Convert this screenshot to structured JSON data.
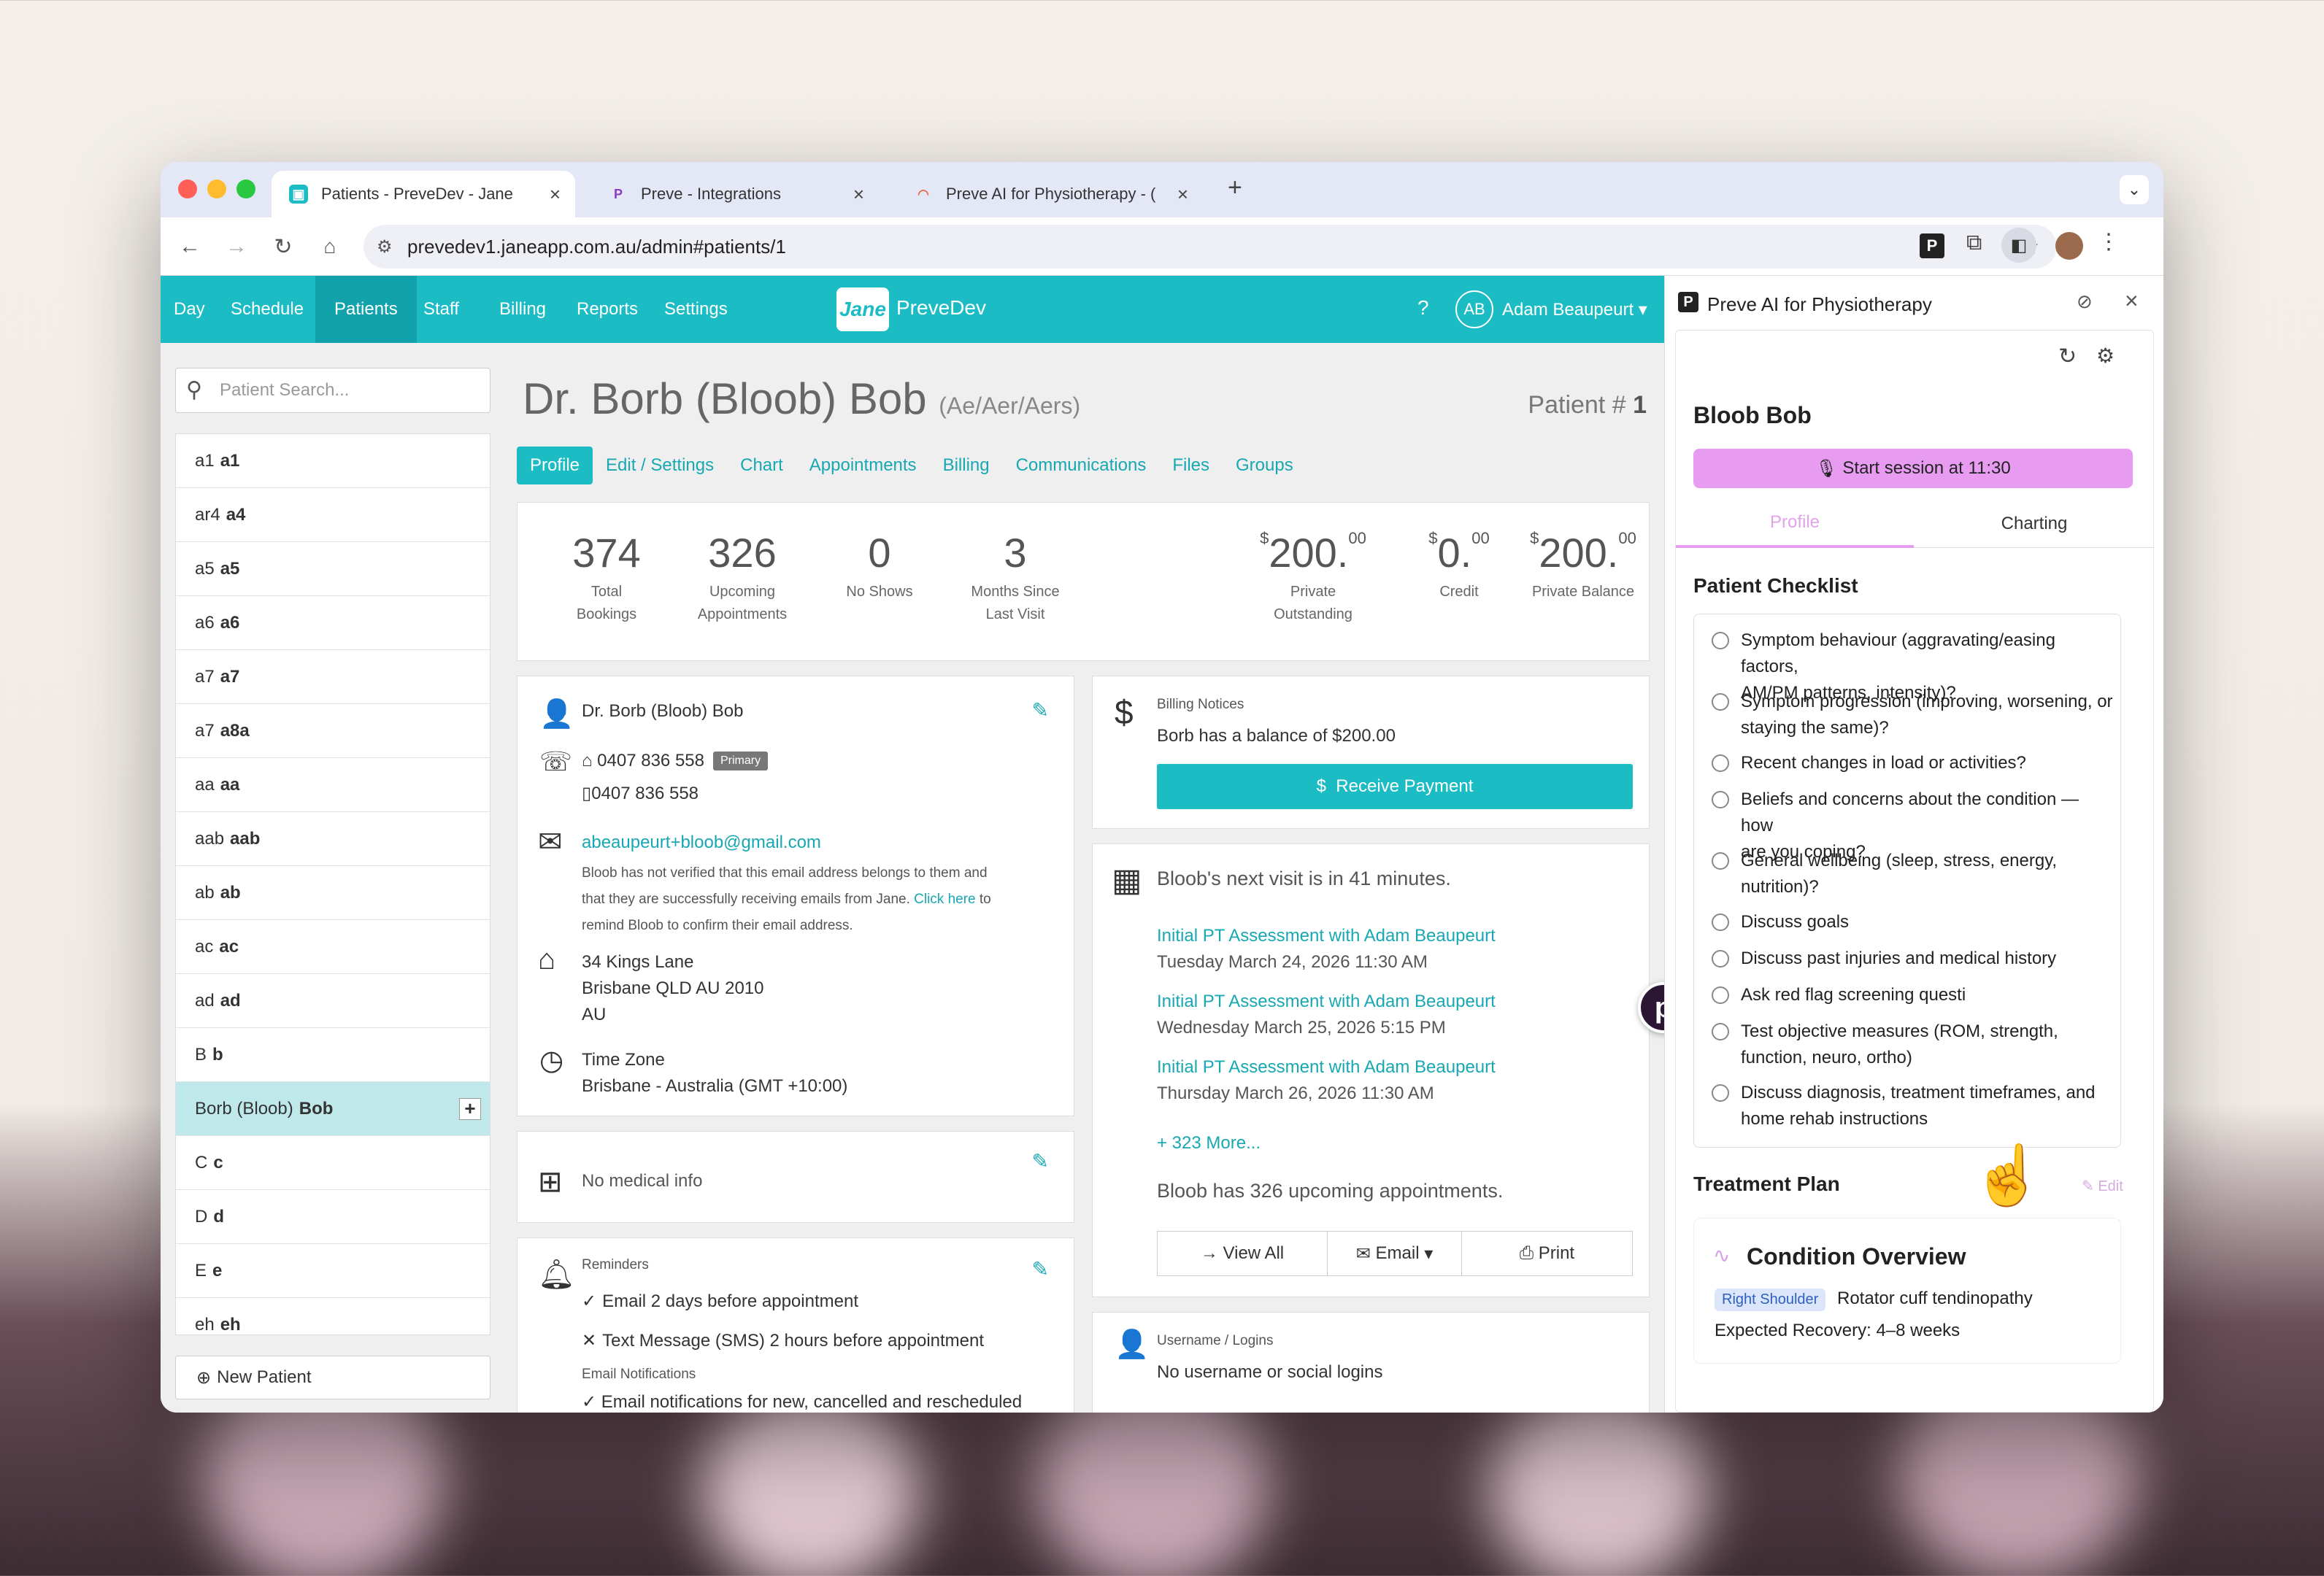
{
  "browser": {
    "tabs": [
      {
        "title": "Patients - PreveDev - Jane",
        "active": true
      },
      {
        "title": "Preve - Integrations",
        "active": false
      },
      {
        "title": "Preve AI for Physiotherapy - (",
        "active": false
      }
    ],
    "url": "prevedev1.janeapp.com.au/admin#patients/1"
  },
  "nav": {
    "items": [
      "Day",
      "Schedule",
      "Patients",
      "Staff",
      "Billing",
      "Reports",
      "Settings"
    ],
    "active": "Patients",
    "logo": "Jane",
    "clinic": "PreveDev",
    "help": "?",
    "user_initials": "AB",
    "user_name": "Adam Beaupeurt"
  },
  "sidebar": {
    "search_placeholder": "Patient Search...",
    "patients": [
      {
        "first": "a1",
        "last": "a1"
      },
      {
        "first": "ar4",
        "last": "a4"
      },
      {
        "first": "a5",
        "last": "a5"
      },
      {
        "first": "a6",
        "last": "a6"
      },
      {
        "first": "a7",
        "last": "a7"
      },
      {
        "first": "a7",
        "last": "a8a"
      },
      {
        "first": "aa",
        "last": "aa"
      },
      {
        "first": "aab",
        "last": "aab"
      },
      {
        "first": "ab",
        "last": "ab"
      },
      {
        "first": "ac",
        "last": "ac"
      },
      {
        "first": "ad",
        "last": "ad"
      },
      {
        "first": "B",
        "last": "b"
      },
      {
        "first": "Borb (Bloob)",
        "last": "Bob",
        "selected": true
      },
      {
        "first": "C",
        "last": "c"
      },
      {
        "first": "D",
        "last": "d"
      },
      {
        "first": "E",
        "last": "e"
      },
      {
        "first": "eh",
        "last": "eh"
      }
    ],
    "new_patient": "New Patient"
  },
  "patient": {
    "name": "Dr. Borb (Bloob) Bob",
    "pronouns": "(Ae/Aer/Aers)",
    "number_label": "Patient #",
    "number": "1",
    "tabs": [
      "Profile",
      "Edit / Settings",
      "Chart",
      "Appointments",
      "Billing",
      "Communications",
      "Files",
      "Groups"
    ],
    "stats": [
      {
        "value": "374",
        "label1": "Total",
        "label2": "Bookings"
      },
      {
        "value": "326",
        "label1": "Upcoming",
        "label2": "Appointments"
      },
      {
        "value": "0",
        "label1": "No Shows",
        "label2": ""
      },
      {
        "value": "3",
        "label1": "Months Since",
        "label2": "Last Visit"
      }
    ],
    "money": [
      {
        "cur": "$",
        "whole": "200.",
        "cents": "00",
        "label1": "Private",
        "label2": "Outstanding"
      },
      {
        "cur": "$",
        "whole": "0.",
        "cents": "00",
        "label1": "Credit",
        "label2": ""
      },
      {
        "cur": "$",
        "whole": "200.",
        "cents": "00",
        "label1": "Private Balance",
        "label2": ""
      }
    ],
    "contact": {
      "name": "Dr. Borb (Bloob) Bob",
      "home_phone": "0407 836 558",
      "primary_badge": "Primary",
      "mobile_phone": "0407 836 558",
      "email": "abeaupeurt+bloob@gmail.com",
      "email_note_1": "Bloob has not verified that this email address belongs to them and",
      "email_note_2a": "that they are successfully receiving emails from Jane.",
      "click_here": "Click here",
      "email_note_2b": "to",
      "email_note_3": "remind Bloob to confirm their email address.",
      "address_1": "34 Kings Lane",
      "address_2": "Brisbane QLD AU 2010",
      "address_3": "AU",
      "tz_label": "Time Zone",
      "tz_value": "Brisbane - Australia (GMT +10:00)"
    },
    "medical": "No medical info",
    "reminders": {
      "label": "Reminders",
      "items": [
        {
          "mark": "✓",
          "text": "Email 2 days before appointment"
        },
        {
          "mark": "✕",
          "text": "Text Message (SMS) 2 hours before appointment"
        }
      ],
      "notif_label": "Email Notifications",
      "notif_item": "Email notifications for new, cancelled and rescheduled"
    },
    "billing": {
      "label": "Billing Notices",
      "text": "Borb has a balance of $200.00",
      "button": "Receive Payment"
    },
    "visits": {
      "headline": "Bloob's next visit is in 41 minutes.",
      "items": [
        {
          "title": "Initial PT Assessment with Adam Beaupeurt",
          "when": "Tuesday March 24, 2026 11:30 AM"
        },
        {
          "title": "Initial PT Assessment with Adam Beaupeurt",
          "when": "Wednesday March 25, 2026 5:15 PM"
        },
        {
          "title": "Initial PT Assessment with Adam Beaupeurt",
          "when": "Thursday March 26, 2026 11:30 AM"
        }
      ],
      "more": "+ 323 More...",
      "summary": "Bloob has 326 upcoming appointments.",
      "view_all": "View All",
      "email": "Email",
      "print": "Print"
    },
    "logins": {
      "label": "Username / Logins",
      "text": "No username or social logins"
    }
  },
  "extension": {
    "title": "Preve AI for Physiotherapy",
    "patient": "Bloob Bob",
    "start_button": "Start session at 11:30",
    "tabs": [
      "Profile",
      "Charting"
    ],
    "checklist_title": "Patient Checklist",
    "checklist": [
      [
        "Symptom behaviour (aggravating/easing factors,",
        "AM/PM patterns, intensity)?"
      ],
      [
        "Symptom progression (improving, worsening, or",
        "staying the same)?"
      ],
      [
        "Recent changes in load or activities?"
      ],
      [
        "Beliefs and concerns about the condition — how",
        "are you coping?"
      ],
      [
        "General wellbeing (sleep, stress, energy,",
        "nutrition)?"
      ],
      [
        "Discuss goals"
      ],
      [
        "Discuss past injuries and medical history"
      ],
      [
        "Ask red flag screening questi"
      ],
      [
        "Test objective measures (ROM, strength,",
        "function, neuro, ortho)"
      ],
      [
        "Discuss diagnosis, treatment timeframes, and",
        "home rehab instructions"
      ]
    ],
    "plan_title": "Treatment Plan",
    "edit": "Edit",
    "condition_title": "Condition Overview",
    "region_tag": "Right Shoulder",
    "condition": "Rotator cuff tendinopathy",
    "recovery": "Expected Recovery: 4–8 weeks"
  },
  "colors": {
    "jane_teal": "#1cbcc4",
    "preve_purple": "#e79cf2",
    "link": "#17a8b2"
  }
}
